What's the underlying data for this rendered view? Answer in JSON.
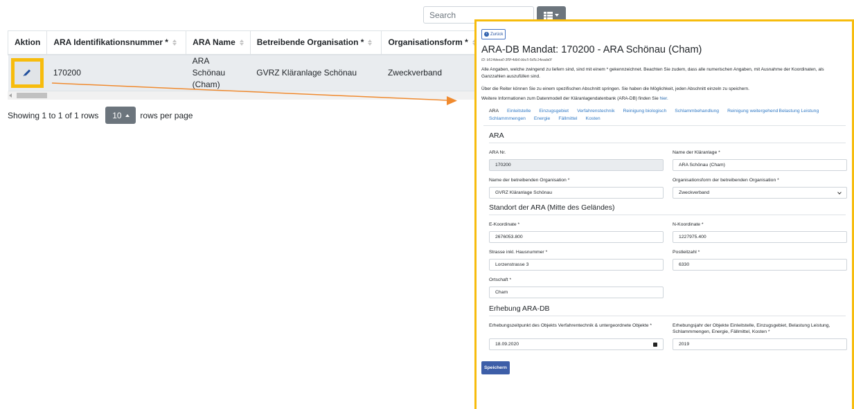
{
  "toolbar": {
    "search_placeholder": "Search",
    "columns_button_icon": "grid-icon"
  },
  "table": {
    "columns": [
      "Aktion",
      "ARA Identifikationsnummer *",
      "ARA Name",
      "Betreibende Organisation *",
      "Organisationsform *"
    ],
    "rows": [
      {
        "action_icon": "pencil-icon",
        "ara_id": "170200",
        "ara_name": "ARA Schönau (Cham)",
        "organisation": "GVRZ Kläranlage Schönau",
        "organisationsform": "Zweckverband"
      }
    ]
  },
  "pagination": {
    "showing": "Showing 1 to 1 of 1 rows",
    "page_size": "10",
    "rows_per_page": "rows per page"
  },
  "panel": {
    "back_label": "Zurück",
    "title": "ARA-DB Mandat: 170200 - ARA Schönau (Cham)",
    "record_id": "ID: b514deea0-3f9f-4db6-bbc5-5d5c14eada0f",
    "intro_1": "Alle Angaben, welche zwingend zu liefern sind, sind mit einem * gekennzeichnet. Beachten Sie zudem, dass alle numerischen Angaben, mit Ausnahme der Koordinaten, als Ganzzahlen auszufüllen sind.",
    "intro_2": "Über die Reiter können Sie zu einem spezifischen Abschnitt springen. Sie haben die Möglichkeit, jeden Abschnitt einzeln zu speichern.",
    "intro_3_prefix": "Weitere Informationen zum Datenmodell der Kläranlagendatenbank (ARA-DB) finden Sie ",
    "intro_3_link": "hier.",
    "tabs": [
      "ARA",
      "Einleitstelle",
      "Einzugsgebiet",
      "Verfahrenstechnik",
      "Reinigung biologisch",
      "Schlammbehandlung",
      "Reinigung weitergehend",
      "Belastung Leistung",
      "Schlammmengen",
      "Energie",
      "Fällmittel",
      "Kosten"
    ],
    "section_ara": "ARA",
    "section_standort": "Standort der ARA (Mitte des Geländes)",
    "section_erhebung": "Erhebung ARA-DB",
    "fields": {
      "ara_nr": {
        "label": "ARA Nr.",
        "value": "170200"
      },
      "name_klaeranlage": {
        "label": "Name der Kläranlage *",
        "value": "ARA Schönau (Cham)"
      },
      "name_organisation": {
        "label": "Name der betreibenden Organisation *",
        "value": "GVRZ Kläranlage Schönau"
      },
      "organisationsform": {
        "label": "Organisationsform der betreibenden Organisation *",
        "value": "Zweckverband"
      },
      "e_koordinate": {
        "label": "E-Koordinate *",
        "value": "2676053.800"
      },
      "n_koordinate": {
        "label": "N-Koordinate *",
        "value": "1227975.400"
      },
      "strasse": {
        "label": "Strasse inkl. Hausnummer *",
        "value": "Lorzenstrasse 3"
      },
      "postleitzahl": {
        "label": "Postleitzahl *",
        "value": "6330"
      },
      "ortschaft": {
        "label": "Ortschaft *",
        "value": "Cham"
      },
      "erhebungszeitpunkt": {
        "label": "Erhebungszeitpunkt des Objekts Verfahrentechnik & untergeordnete Objekte *",
        "value": "18.09.2020"
      },
      "erhebungsjahr": {
        "label": "Erhebungsjahr der Objekte Einleitstelle, Einzugsgebiet, Belastung Leistung, Schlammmengen, Energie, Fällmittel, Kosten *",
        "value": "2019"
      }
    },
    "save_label": "Speichern"
  },
  "colors": {
    "highlight": "#f7bc0d",
    "arrow": "#f08a2e",
    "primary": "#3d5ea8",
    "link": "#2f78c4"
  }
}
